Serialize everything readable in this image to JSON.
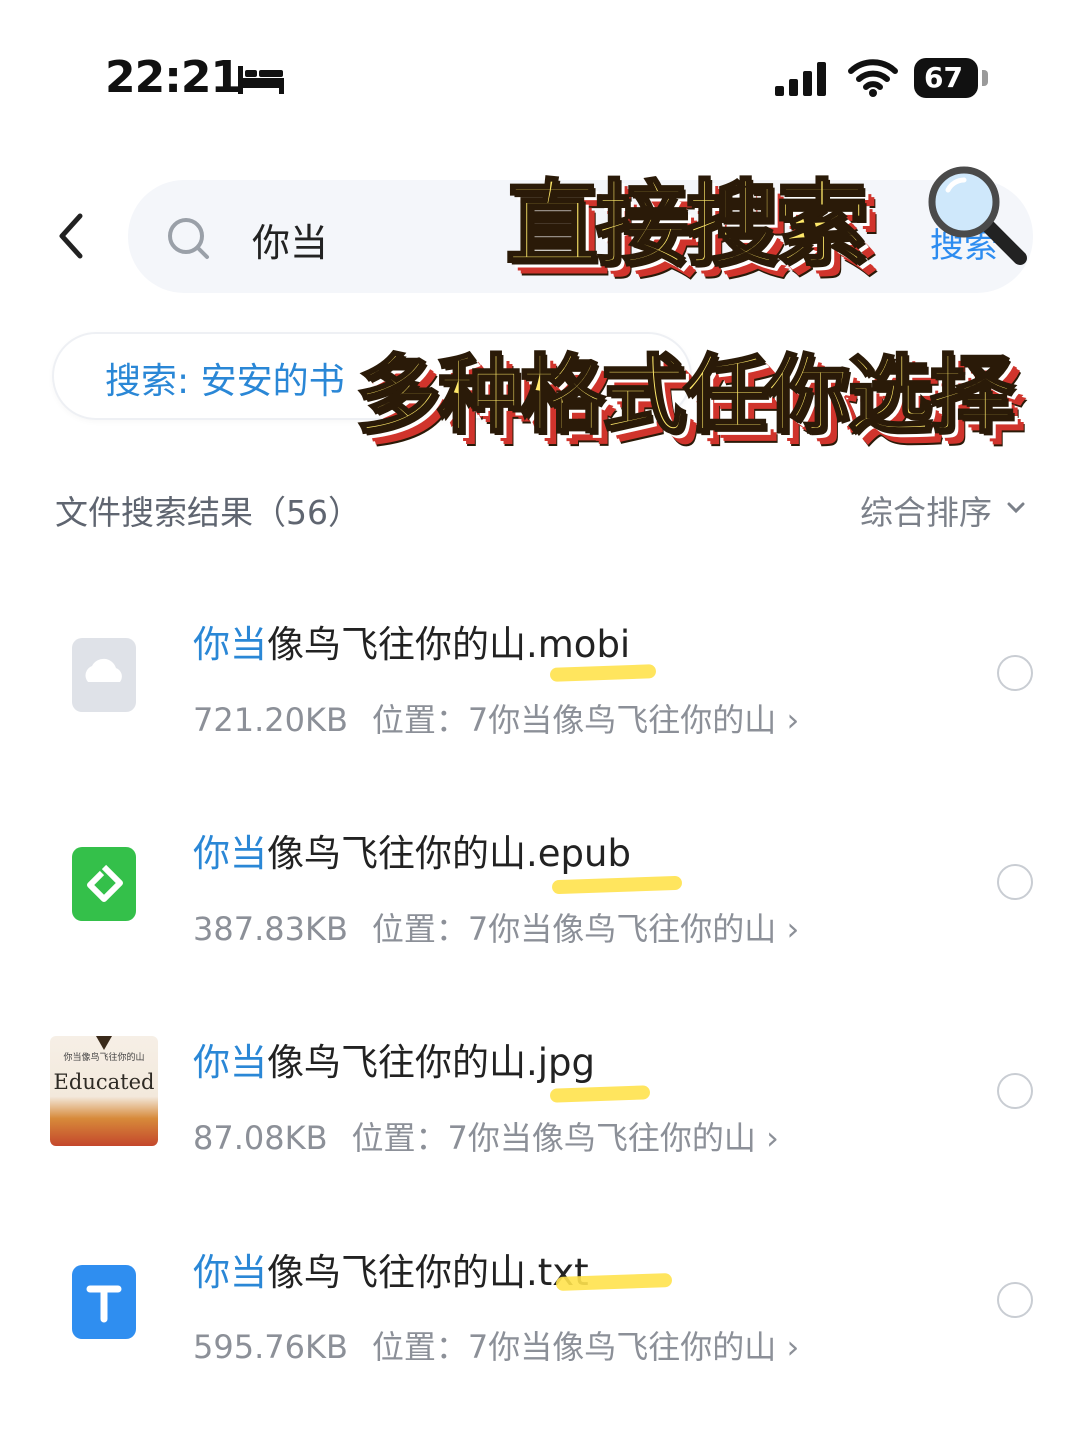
{
  "status_bar": {
    "time": "22:21",
    "battery": "67"
  },
  "search": {
    "query": "你当",
    "action": "搜索"
  },
  "suggestion": {
    "text": "搜索: 安安的书"
  },
  "overlays": {
    "line1": "直接搜索",
    "line2": "多种格式任你选择"
  },
  "results": {
    "title": "文件搜索结果（56）",
    "sort_label": "综合排序",
    "items": [
      {
        "highlight": "你当",
        "rest": "像鸟飞往你的山.mobi",
        "size": "721.20KB",
        "location": "位置：7你当像鸟飞往你的山 ›",
        "icon": "cloud-file-icon"
      },
      {
        "highlight": "你当",
        "rest": "像鸟飞往你的山.epub",
        "size": "387.83KB",
        "location": "位置：7你当像鸟飞往你的山 ›",
        "icon": "epub-file-icon"
      },
      {
        "highlight": "你当",
        "rest": "像鸟飞往你的山.jpg",
        "size": "87.08KB",
        "location": "位置：7你当像鸟飞往你的山 ›",
        "icon": "image-thumbnail"
      },
      {
        "highlight": "你当",
        "rest": "像鸟飞往你的山.txt",
        "size": "595.76KB",
        "location": "位置：7你当像鸟飞往你的山 ›",
        "icon": "txt-file-icon"
      }
    ]
  },
  "cover": {
    "cn_title": "你当像鸟飞往你的山",
    "en_title": "Educated"
  },
  "colors": {
    "accent_blue": "#2a87d6",
    "overlay_yellow": "#ffe96a",
    "overlay_red": "#d0342c",
    "marker_yellow": "#ffe24d"
  }
}
